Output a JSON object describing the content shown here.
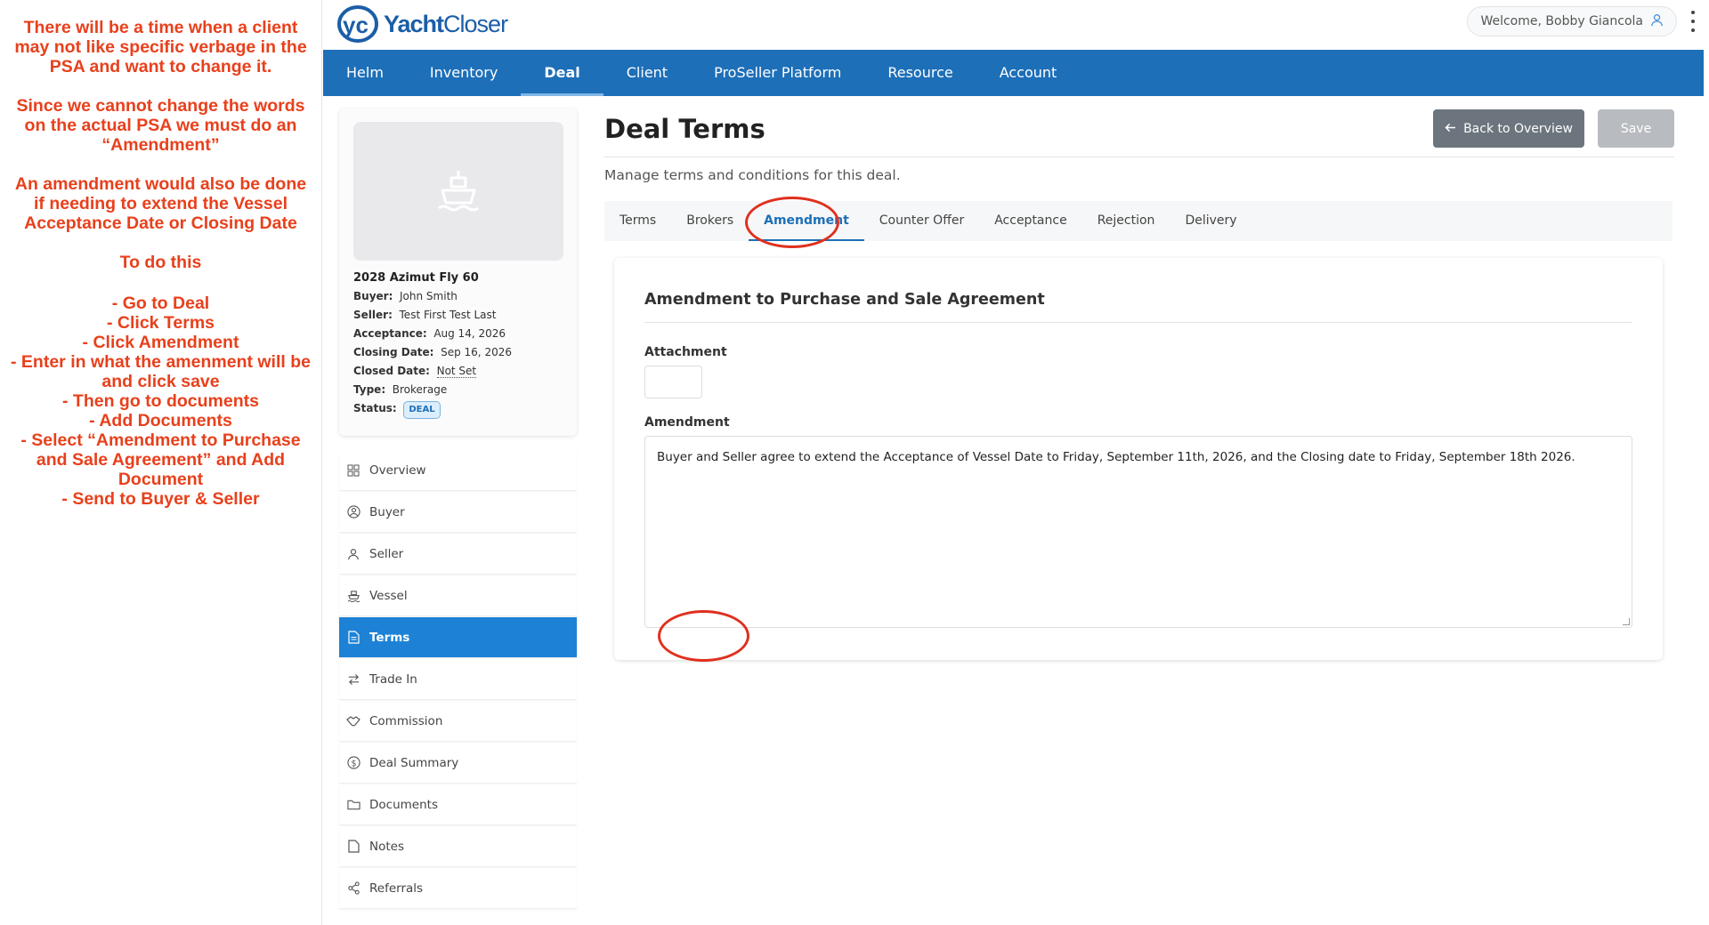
{
  "annotation": {
    "paragraphs": [
      "There will be a time when a client may not like specific verbage in the PSA and want to change it.",
      "Since we cannot change the words on the actual PSA we must do an “Amendment”",
      "An amendment would also be done if needing to extend the Vessel Acceptance Date or Closing Date",
      "To do this",
      "- Go to Deal\n- Click Terms\n- Click Amendment\n- Enter in what the amenment will be and click save\n- Then go to documents\n- Add Documents\n- Select “Amendment to Purchase and Sale Agreement” and Add Document\n- Send to Buyer & Seller"
    ]
  },
  "header": {
    "logo_mark": "yc",
    "logo_word_bold": "Yacht",
    "logo_word_rest": "Closer",
    "welcome": "Welcome, Bobby Giancola"
  },
  "nav": {
    "items": [
      "Helm",
      "Inventory",
      "Deal",
      "Client",
      "ProSeller Platform",
      "Resource",
      "Account"
    ],
    "active": "Deal"
  },
  "deal": {
    "name": "2028 Azimut Fly 60",
    "buyer_label": "Buyer:",
    "buyer": "John Smith",
    "seller_label": "Seller:",
    "seller": "Test First Test Last",
    "acceptance_label": "Acceptance:",
    "acceptance": "Aug 14, 2026",
    "closing_label": "Closing Date:",
    "closing": "Sep 16, 2026",
    "closed_label": "Closed Date:",
    "closed": "Not Set",
    "type_label": "Type:",
    "type": "Brokerage",
    "status_label": "Status:",
    "status": "DEAL"
  },
  "sidemenu": {
    "items": [
      "Overview",
      "Buyer",
      "Seller",
      "Vessel",
      "Terms",
      "Trade In",
      "Commission",
      "Deal Summary",
      "Documents",
      "Notes",
      "Referrals"
    ],
    "active": "Terms"
  },
  "main": {
    "title": "Deal Terms",
    "subtitle": "Manage terms and conditions for this deal.",
    "back_label": "Back to Overview",
    "save_label": "Save",
    "tabs": [
      "Terms",
      "Brokers",
      "Amendment",
      "Counter Offer",
      "Acceptance",
      "Rejection",
      "Delivery"
    ],
    "active_tab": "Amendment"
  },
  "panel": {
    "title": "Amendment to Purchase and Sale Agreement",
    "attachment_label": "Attachment",
    "amendment_label": "Amendment",
    "amendment_text": "Buyer and Seller agree to extend the Acceptance of Vessel Date to Friday, September 11th, 2026, and the Closing date to Friday, September 18th 2026."
  },
  "colors": {
    "nav_bg": "#1d6fb8",
    "annotation_red": "#e8401c",
    "active_item": "#1d82d6"
  }
}
